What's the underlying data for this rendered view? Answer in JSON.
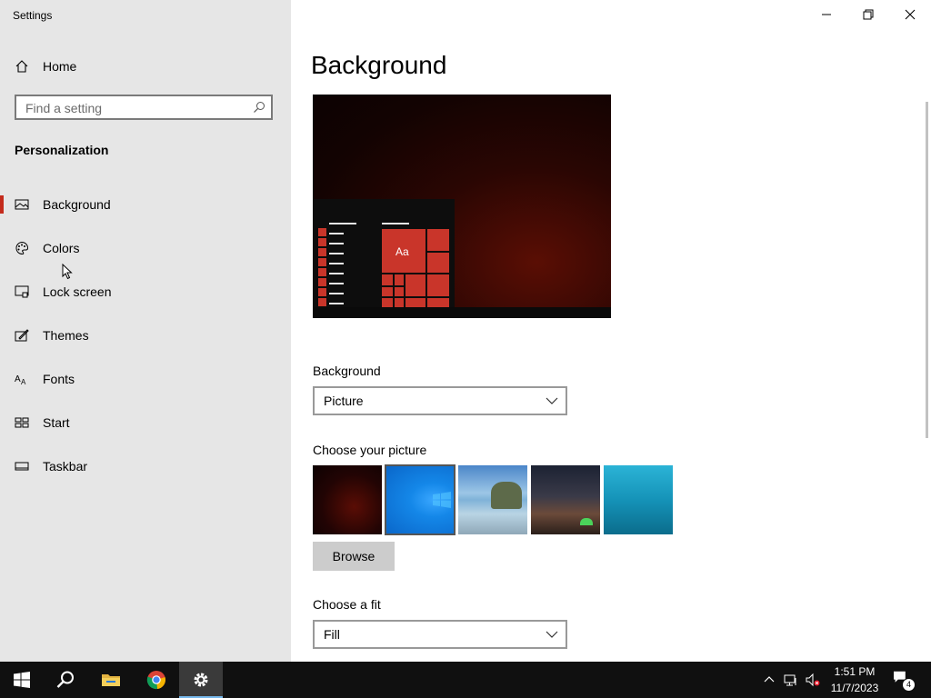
{
  "window": {
    "title": "Settings",
    "controls": {
      "minimize": "minimize",
      "maximize": "restore",
      "close": "close"
    }
  },
  "sidebar": {
    "home_label": "Home",
    "search_placeholder": "Find a setting",
    "section_title": "Personalization",
    "items": [
      {
        "label": "Background",
        "icon": "picture-icon",
        "selected": true
      },
      {
        "label": "Colors",
        "icon": "palette-icon",
        "selected": false
      },
      {
        "label": "Lock screen",
        "icon": "lock-screen-icon",
        "selected": false
      },
      {
        "label": "Themes",
        "icon": "themes-icon",
        "selected": false
      },
      {
        "label": "Fonts",
        "icon": "fonts-icon",
        "selected": false
      },
      {
        "label": "Start",
        "icon": "start-icon",
        "selected": false
      },
      {
        "label": "Taskbar",
        "icon": "taskbar-icon",
        "selected": false
      }
    ],
    "accent_color": "#c42b1c"
  },
  "main": {
    "page_title": "Background",
    "preview": {
      "tile_label": "Aa"
    },
    "background_label": "Background",
    "background_value": "Picture",
    "choose_picture_label": "Choose your picture",
    "pictures": [
      {
        "name": "dark-red-wallpaper",
        "selected": false
      },
      {
        "name": "windows-blue-wallpaper",
        "selected": true
      },
      {
        "name": "beach-rock-wallpaper",
        "selected": false
      },
      {
        "name": "night-sky-tent-wallpaper",
        "selected": false
      },
      {
        "name": "underwater-swimmer-wallpaper",
        "selected": false
      }
    ],
    "browse_label": "Browse",
    "choose_fit_label": "Choose a fit",
    "fit_value": "Fill"
  },
  "taskbar": {
    "apps": [
      "start-icon",
      "search-icon",
      "file-explorer-icon",
      "chrome-icon",
      "settings-icon"
    ],
    "active_app": "settings-icon",
    "tray": [
      "chevron-up-icon",
      "network-icon",
      "volume-muted-icon"
    ],
    "time": "1:51 PM",
    "date": "11/7/2023",
    "notification_count": "4"
  }
}
